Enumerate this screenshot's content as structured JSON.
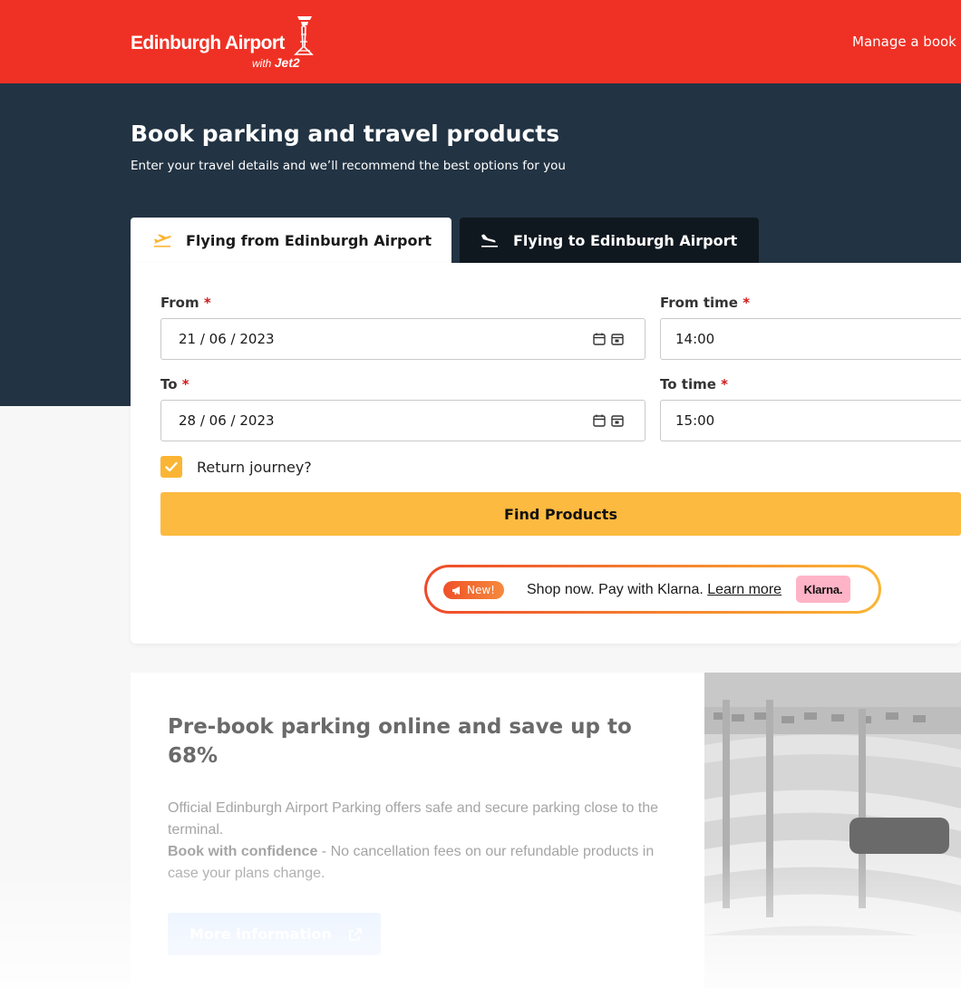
{
  "header": {
    "logo_title": "Edinburgh Airport",
    "logo_with": "with",
    "logo_brand": "Jet2",
    "manage_link": "Manage a book"
  },
  "hero": {
    "title": "Book parking and travel products",
    "subtitle": "Enter your travel details and we’ll recommend the best options for you"
  },
  "tabs": [
    {
      "label": "Flying from Edinburgh Airport",
      "icon": "plane-takeoff-icon",
      "selected": true
    },
    {
      "label": "Flying to Edinburgh Airport",
      "icon": "plane-landing-icon",
      "selected": false
    }
  ],
  "form": {
    "required_mark": "*",
    "from_label": "From",
    "from_value": "21 / 06 / 2023",
    "from_time_label": "From time",
    "from_time_value": "14:00",
    "to_label": "To",
    "to_value": "28 / 06 / 2023",
    "to_time_label": "To time",
    "to_time_value": "15:00",
    "return_label": "Return journey?",
    "return_checked": true,
    "submit_label": "Find Products"
  },
  "klarna": {
    "badge": "New!",
    "text": "Shop now. Pay with Klarna.",
    "link": "Learn more",
    "logo": "Klarna."
  },
  "promo": {
    "title": "Pre-book parking online and save up to 68%",
    "text": "Official Edinburgh Airport Parking offers safe and secure parking close to the terminal.",
    "bold": "Book with confidence",
    "text2": " - No cancellation fees on our refundable products in case your plans change.",
    "button": "More information"
  },
  "colors": {
    "brand_red": "#ef3125",
    "hero_navy": "#223343",
    "accent_yellow": "#fdba40",
    "klarna_pink": "#ffb3c7"
  }
}
